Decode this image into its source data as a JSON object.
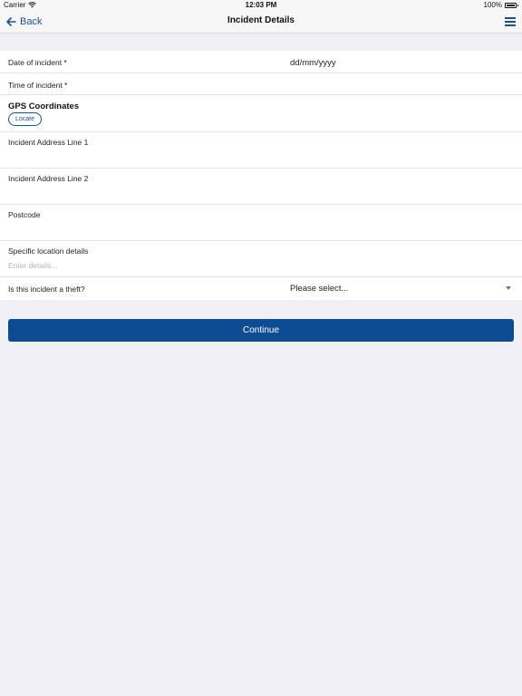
{
  "status_bar": {
    "carrier": "Carrier",
    "time": "12:03 PM",
    "battery": "100%",
    "wifi_icon": "wifi-icon",
    "battery_icon": "battery-icon"
  },
  "nav": {
    "back_label": "Back",
    "back_icon": "arrow-left-icon",
    "title": "Incident Details",
    "menu_icon": "hamburger-menu-icon"
  },
  "form": {
    "date": {
      "label": "Date of incident *",
      "value": "dd/mm/yyyy"
    },
    "time": {
      "label": "Time of incident *"
    },
    "gps": {
      "label": "GPS Coordinates",
      "locate_label": "Locate"
    },
    "address1": {
      "label": "Incident Address Line 1",
      "value": ""
    },
    "address2": {
      "label": "Incident Address Line 2",
      "value": ""
    },
    "postcode": {
      "label": "Postcode",
      "value": ""
    },
    "location_details": {
      "label": "Specific location details",
      "placeholder": "Enter details..."
    },
    "theft": {
      "label": "Is this incident a theft?",
      "selected": "Please select..."
    }
  },
  "actions": {
    "continue_label": "Continue"
  },
  "colors": {
    "accent": "#1a4f8b",
    "button": "#0d4b93",
    "background": "#efeff4"
  }
}
